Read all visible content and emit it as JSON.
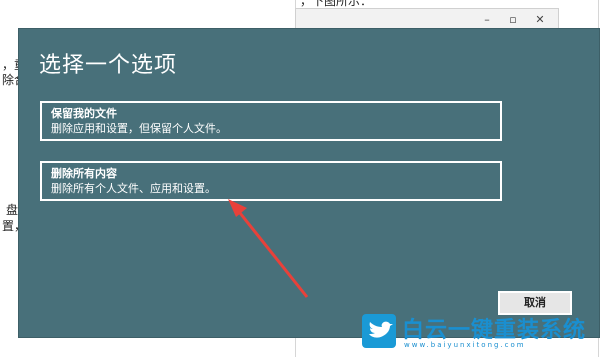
{
  "background": {
    "frag_top": "，下图所示：",
    "frag_left1": "，重",
    "frag_left2": "除合",
    "frag_left3": "盘",
    "frag_left4": "置，"
  },
  "dialog": {
    "title": "选择一个选项",
    "options": [
      {
        "title": "保留我的文件",
        "description": "删除应用和设置，但保留个人文件。"
      },
      {
        "title": "删除所有内容",
        "description": "删除所有个人文件、应用和设置。"
      }
    ],
    "cancel_label": "取消"
  },
  "watermark": {
    "text": "白云一键重装系统",
    "url": "www.baiyunxitong.com"
  },
  "colors": {
    "dialog_bg": "#48707a",
    "arrow": "#e8413a",
    "watermark": "#1a8fd0"
  }
}
